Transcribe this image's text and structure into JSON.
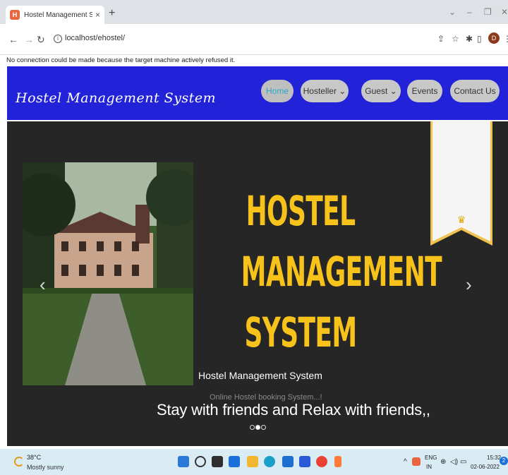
{
  "browser": {
    "tab_title": "Hostel Management System",
    "favicon_letter": "H",
    "tab_close": "×",
    "new_tab": "+",
    "url": "localhost/ehostel/",
    "profile_initial": "D",
    "error_message": "No connection could be made because the target machine actively refused it."
  },
  "site": {
    "logo": "Hostel Management System",
    "nav": [
      {
        "label": "Home"
      },
      {
        "label": "Hosteller ⌄"
      },
      {
        "label": "Guest ⌄"
      },
      {
        "label": "Events"
      },
      {
        "label": "Contact Us"
      }
    ]
  },
  "hero": {
    "title_lines": [
      "HOSTEL",
      "MANAGEMENT",
      "SYSTEM"
    ],
    "caption_title": "Hostel Management System",
    "caption_sub": "Online Hostel booking System...!",
    "tagline": "Stay with friends and Relax with friends,,",
    "prev_arrow": "‹",
    "next_arrow": "›",
    "slide_count": 3,
    "active_slide": 2
  },
  "taskbar": {
    "temperature": "38°C",
    "weather": "Mostly sunny",
    "lang_top": "ENG",
    "lang_bottom": "IN",
    "time": "15:32",
    "date": "02-06-2022",
    "notification_count": "2"
  },
  "colors": {
    "header_blue": "#2222d9",
    "title_yellow": "#f7c21a",
    "hero_bg": "#262626",
    "nav_active_text": "#2aa9c7"
  }
}
